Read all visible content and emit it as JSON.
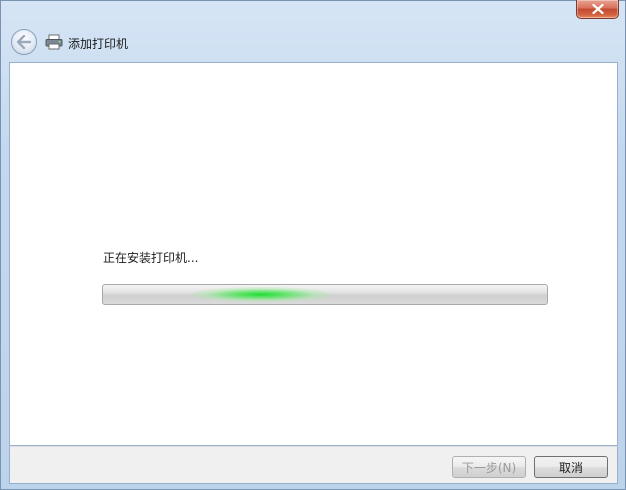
{
  "window": {
    "title": "添加打印机",
    "close_icon": "close-icon",
    "back_icon": "back-arrow-icon",
    "title_icon": "printer-icon"
  },
  "install": {
    "status": "正在安装打印机...",
    "progress_indeterminate": true
  },
  "footer": {
    "next_label": "下一步(N)",
    "cancel_label": "取消"
  },
  "colors": {
    "close_red": "#c24a31",
    "progress_green": "#1edc32",
    "frame_blue": "#c4d9ef"
  }
}
